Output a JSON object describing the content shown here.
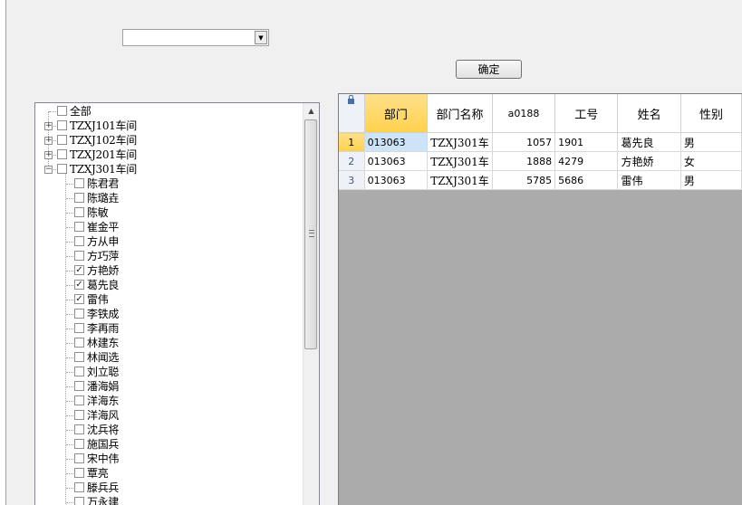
{
  "filter": {
    "combo_value": "",
    "ok_label": "确定"
  },
  "tree": {
    "nodes": [
      {
        "label": "全部",
        "level": 0,
        "checked": false,
        "expander": ""
      },
      {
        "label": "TZXJ101车间",
        "level": 1,
        "checked": false,
        "expander": "+"
      },
      {
        "label": "TZXJ102车间",
        "level": 1,
        "checked": false,
        "expander": "+"
      },
      {
        "label": "TZXJ201车间",
        "level": 1,
        "checked": false,
        "expander": "+"
      },
      {
        "label": "TZXJ301车间",
        "level": 1,
        "checked": false,
        "expander": "-"
      },
      {
        "label": "陈君君",
        "level": 2,
        "checked": false
      },
      {
        "label": "陈璐垚",
        "level": 2,
        "checked": false
      },
      {
        "label": "陈敏",
        "level": 2,
        "checked": false
      },
      {
        "label": "崔金平",
        "level": 2,
        "checked": false
      },
      {
        "label": "方从申",
        "level": 2,
        "checked": false
      },
      {
        "label": "方巧萍",
        "level": 2,
        "checked": false
      },
      {
        "label": "方艳娇",
        "level": 2,
        "checked": true
      },
      {
        "label": "葛先良",
        "level": 2,
        "checked": true
      },
      {
        "label": "雷伟",
        "level": 2,
        "checked": true
      },
      {
        "label": "李铁成",
        "level": 2,
        "checked": false
      },
      {
        "label": "李再雨",
        "level": 2,
        "checked": false
      },
      {
        "label": "林建东",
        "level": 2,
        "checked": false
      },
      {
        "label": "林闻选",
        "level": 2,
        "checked": false
      },
      {
        "label": "刘立聪",
        "level": 2,
        "checked": false
      },
      {
        "label": "潘海娟",
        "level": 2,
        "checked": false
      },
      {
        "label": "洋海东",
        "level": 2,
        "checked": false
      },
      {
        "label": "洋海风",
        "level": 2,
        "checked": false
      },
      {
        "label": "沈兵将",
        "level": 2,
        "checked": false
      },
      {
        "label": "施国兵",
        "level": 2,
        "checked": false
      },
      {
        "label": "宋中伟",
        "level": 2,
        "checked": false
      },
      {
        "label": "覃亮",
        "level": 2,
        "checked": false
      },
      {
        "label": "滕兵兵",
        "level": 2,
        "checked": false
      },
      {
        "label": "万永建",
        "level": 2,
        "checked": false
      }
    ]
  },
  "grid": {
    "columns": [
      "部门",
      "部门名称",
      "a0188",
      "工号",
      "姓名",
      "性别"
    ],
    "rows": [
      {
        "num": "1",
        "cells": [
          "013063",
          "TZXJ301车",
          "1057",
          "1901",
          "葛先良",
          "男"
        ]
      },
      {
        "num": "2",
        "cells": [
          "013063",
          "TZXJ301车",
          "1888",
          "4279",
          "方艳娇",
          "女"
        ]
      },
      {
        "num": "3",
        "cells": [
          "013063",
          "TZXJ301车",
          "5785",
          "5686",
          "雷伟",
          "男"
        ]
      }
    ]
  },
  "icons": {
    "lock": "lock-icon",
    "expand": "plus-box-icon",
    "collapse": "minus-box-icon",
    "check": "checkmark-icon"
  }
}
